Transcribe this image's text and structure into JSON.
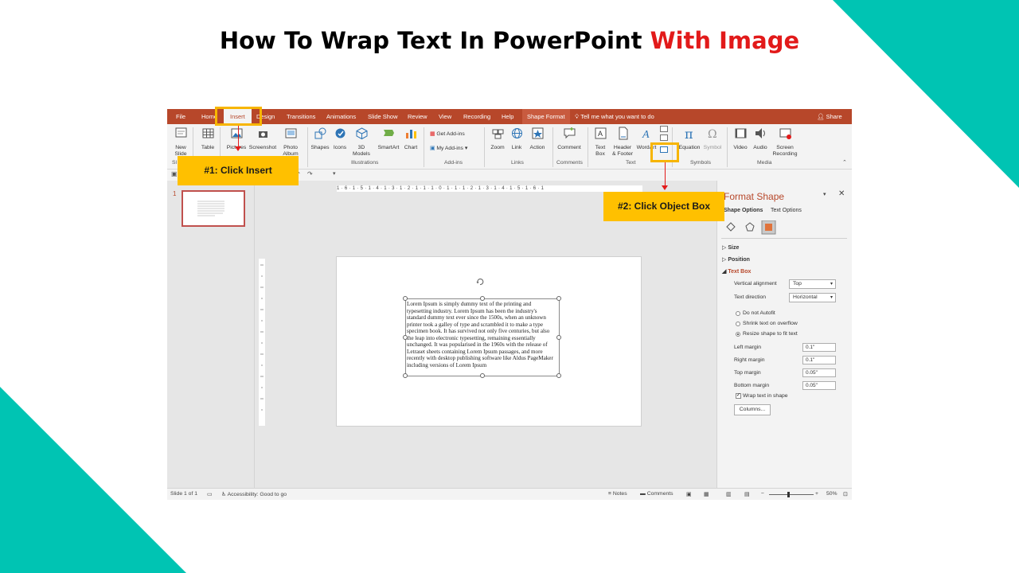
{
  "page": {
    "title_main": "How To Wrap Text In PowerPoint",
    "title_highlight": "With Image",
    "accent_color": "#00c4b3",
    "highlight_color": "#e21a1a"
  },
  "ribbon_tabs": {
    "file": "File",
    "home": "Home",
    "insert": "Insert",
    "design": "Design",
    "transitions": "Transitions",
    "animations": "Animations",
    "slide_show": "Slide Show",
    "review": "Review",
    "view": "View",
    "recording": "Recording",
    "help": "Help",
    "shape_format": "Shape Format",
    "tell_me": "Tell me what you want to do",
    "share": "Share"
  },
  "ribbon": {
    "new_slide": "New",
    "new_slide_2": "Slide",
    "table": "Table",
    "pictures": "Pictures",
    "screenshot": "Screenshot",
    "photo_album": "Photo",
    "photo_album_2": "Album",
    "shapes": "Shapes",
    "icons": "Icons",
    "models_3d": "3D",
    "models_3d_2": "Models",
    "smartart": "SmartArt",
    "chart": "Chart",
    "get_addins": "Get Add-ins",
    "my_addins": "My Add-ins",
    "zoom": "Zoom",
    "link": "Link",
    "action": "Action",
    "comment": "Comment",
    "text_box": "Text",
    "text_box_2": "Box",
    "header_footer": "Header",
    "header_footer_2": "& Footer",
    "wordart": "WordArt",
    "equation": "Equation",
    "symbol": "Symbol",
    "video": "Video",
    "audio": "Audio",
    "screen_recording": "Screen",
    "screen_recording_2": "Recording",
    "group_slides": "Sl",
    "group_illustrations": "Illustrations",
    "group_addins": "Add-ins",
    "group_links": "Links",
    "group_comments": "Comments",
    "group_text": "Text",
    "group_symbols": "Symbols",
    "group_media": "Media"
  },
  "ruler": {
    "horizontal": "1 · 6 · 1 · 5 · 1 · 4 · 1 · 3 · 1 · 2 · 1 · 1 · 1 · 0 · 1 · 1 · 1 · 2 · 1 · 3 · 1 · 4 · 1 · 5 · 1 · 6 · 1"
  },
  "thumbnail": {
    "number": "1"
  },
  "textbox": {
    "content": "Lorem Ipsum is simply dummy text of the printing and typesetting industry. Lorem Ipsum has been the industry's standard dummy text ever since the 1500s, when an unknown printer took a galley of type and scrambled it to make a type specimen book. It has survived not only five centuries, but also the leap into electronic typesetting, remaining essentially unchanged. It was popularised in the 1960s with the release of Letraset sheets containing Lorem Ipsum passages, and more recently with desktop publishing software like Aldus PageMaker including versions of Lorem Ipsum"
  },
  "format_pane": {
    "title": "Format Shape",
    "tab_shape_options": "Shape Options",
    "tab_text_options": "Text Options",
    "section_size": "Size",
    "section_position": "Position",
    "section_text_box": "Text Box",
    "vertical_alignment_label": "Vertical alignment",
    "vertical_alignment_value": "Top",
    "text_direction_label": "Text direction",
    "text_direction_value": "Horizontal",
    "do_not_autofit": "Do not Autofit",
    "shrink_text": "Shrink text on overflow",
    "resize_shape": "Resize shape to fit text",
    "left_margin_label": "Left margin",
    "left_margin_value": "0.1\"",
    "right_margin_label": "Right margin",
    "right_margin_value": "0.1\"",
    "top_margin_label": "Top margin",
    "top_margin_value": "0.05\"",
    "bottom_margin_label": "Bottom margin",
    "bottom_margin_value": "0.05\"",
    "wrap_text": "Wrap text in shape",
    "columns_button": "Columns..."
  },
  "status_bar": {
    "slide_info": "Slide 1 of 1",
    "accessibility": "Accessibility: Good to go",
    "notes": "Notes",
    "comments": "Comments",
    "zoom": "50%"
  },
  "callouts": {
    "step1": "#1: Click Insert",
    "step2": "#2: Click Object Box"
  }
}
